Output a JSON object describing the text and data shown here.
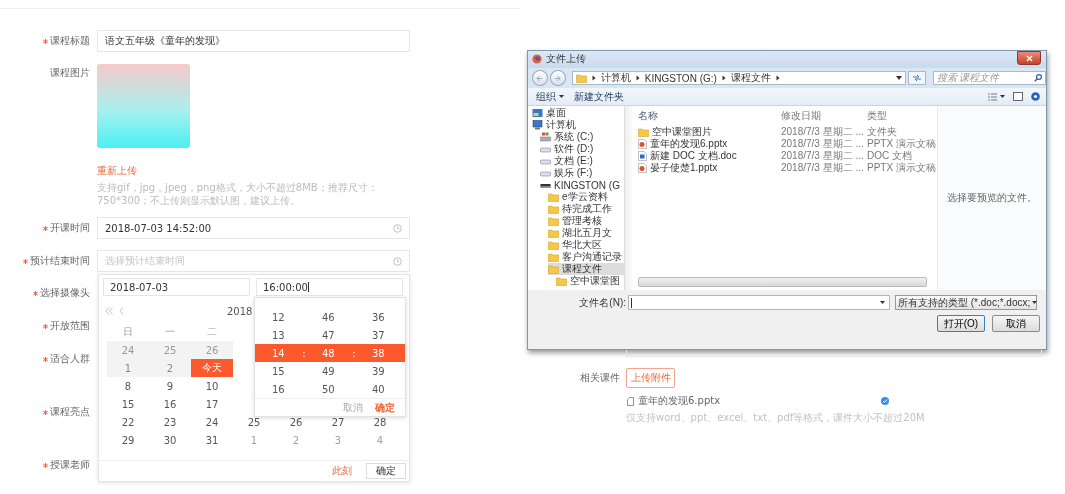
{
  "course_form": {
    "fields": [
      {
        "kind": "text",
        "label": "课程标题",
        "required": true,
        "value": "语文五年级《童年的发现》"
      },
      {
        "kind": "image",
        "label": "课程图片",
        "required": false,
        "link": "重新上传",
        "hint": "支持gif，jpg，jpeg，png格式，大小不超过8MB；推荐尺寸：750*300；不上传则显示默认图，建议上传。"
      },
      {
        "kind": "time",
        "label": "开课时间",
        "required": true,
        "value": "2018-07-03 14:52:00"
      },
      {
        "kind": "time",
        "label": "预计结束时间",
        "required": true,
        "placeholder": "选择预计结束时间"
      },
      {
        "kind": "select",
        "label": "选择摄像头",
        "required": true
      },
      {
        "kind": "select",
        "label": "开放范围",
        "required": true
      },
      {
        "kind": "textarea",
        "label": "适合人群",
        "required": true
      },
      {
        "kind": "textarea",
        "label": "课程亮点",
        "required": true
      },
      {
        "kind": "select",
        "label": "授课老师",
        "required": true
      }
    ]
  },
  "date_picker": {
    "date_value": "2018-07-03",
    "time_value": "16:00:00",
    "year": "2018",
    "weekdays": [
      "日",
      "一",
      "二"
    ],
    "weeks": [
      [
        {
          "text": "24",
          "other_month": true,
          "disabled": true,
          "selected": false
        },
        {
          "text": "25",
          "other_month": true,
          "disabled": true,
          "selected": false
        },
        {
          "text": "26",
          "other_month": true,
          "disabled": true,
          "selected": false
        }
      ],
      [
        {
          "text": "1",
          "other_month": false,
          "disabled": true,
          "selected": false
        },
        {
          "text": "2",
          "other_month": false,
          "disabled": true,
          "selected": false
        },
        {
          "text": "今天",
          "other_month": false,
          "disabled": false,
          "selected": true
        }
      ],
      [
        {
          "text": "8",
          "other_month": false,
          "disabled": false,
          "selected": false
        },
        {
          "text": "9",
          "other_month": false,
          "disabled": false,
          "selected": false
        },
        {
          "text": "10",
          "other_month": false,
          "disabled": false,
          "selected": false
        }
      ],
      [
        {
          "text": "15",
          "other_month": false,
          "disabled": false,
          "selected": false
        },
        {
          "text": "16",
          "other_month": false,
          "disabled": false,
          "selected": false
        },
        {
          "text": "17",
          "other_month": false,
          "disabled": false,
          "selected": false
        }
      ],
      [
        {
          "text": "22",
          "other_month": false,
          "disabled": false,
          "selected": false
        },
        {
          "text": "23",
          "other_month": false,
          "disabled": false,
          "selected": false
        },
        {
          "text": "24",
          "other_month": false,
          "disabled": false,
          "selected": false
        },
        {
          "text": "25",
          "other_month": false,
          "disabled": false,
          "selected": false
        },
        {
          "text": "26",
          "other_month": false,
          "disabled": false,
          "selected": false
        },
        {
          "text": "27",
          "other_month": false,
          "disabled": false,
          "selected": false
        },
        {
          "text": "28",
          "other_month": false,
          "disabled": false,
          "selected": false
        }
      ],
      [
        {
          "text": "29",
          "other_month": false,
          "disabled": false,
          "selected": false
        },
        {
          "text": "30",
          "other_month": false,
          "disabled": false,
          "selected": false
        },
        {
          "text": "31",
          "other_month": false,
          "disabled": false,
          "selected": false
        },
        {
          "text": "1",
          "other_month": true,
          "disabled": false,
          "selected": false
        },
        {
          "text": "2",
          "other_month": true,
          "disabled": false,
          "selected": false
        },
        {
          "text": "3",
          "other_month": true,
          "disabled": false,
          "selected": false
        },
        {
          "text": "4",
          "other_month": true,
          "disabled": false,
          "selected": false
        }
      ]
    ],
    "now_link": "此刻",
    "confirm": "确定",
    "time_panel": {
      "separator": ":",
      "rows": [
        {
          "hour": "12",
          "minute": "46",
          "second": "36",
          "selected": false
        },
        {
          "hour": "13",
          "minute": "47",
          "second": "37",
          "selected": false
        },
        {
          "hour": "14",
          "minute": "48",
          "second": "38",
          "selected": true
        },
        {
          "hour": "15",
          "minute": "49",
          "second": "39",
          "selected": false
        },
        {
          "hour": "16",
          "minute": "50",
          "second": "40",
          "selected": false
        }
      ],
      "cancel": "取消",
      "confirm": "确定"
    }
  },
  "file_dialog": {
    "title": "文件上传",
    "path": [
      "计算机",
      "KINGSTON (G:)",
      "课程文件"
    ],
    "search_placeholder": "搜索 课程文件",
    "toolbar": [
      {
        "label": "组织",
        "dropdown": true
      },
      {
        "label": "新建文件夹",
        "dropdown": false
      }
    ],
    "nav_tree": [
      {
        "label": "桌面",
        "kind": "desktop",
        "selected": false
      },
      {
        "label": "计算机",
        "kind": "computer",
        "selected": false,
        "children": [
          {
            "label": "系统 (C:)",
            "kind": "system-drive",
            "selected": false
          },
          {
            "label": "软件 (D:)",
            "kind": "drive",
            "selected": false
          },
          {
            "label": "文档 (E:)",
            "kind": "drive",
            "selected": false
          },
          {
            "label": "娱乐 (F:)",
            "kind": "drive",
            "selected": false
          },
          {
            "label": "KINGSTON (G",
            "kind": "usb",
            "selected": false,
            "children": [
              {
                "label": "e学云资料",
                "kind": "folder",
                "selected": false
              },
              {
                "label": "待完成工作",
                "kind": "folder",
                "selected": false
              },
              {
                "label": "管理考核",
                "kind": "folder",
                "selected": false
              },
              {
                "label": "湖北五月文",
                "kind": "folder",
                "selected": false
              },
              {
                "label": "华北大区",
                "kind": "folder",
                "selected": false
              },
              {
                "label": "客户沟通记录",
                "kind": "folder",
                "selected": false
              },
              {
                "label": "课程文件",
                "kind": "folder",
                "selected": true,
                "children": [
                  {
                    "label": "空中课堂图",
                    "kind": "folder",
                    "selected": false
                  }
                ]
              }
            ]
          }
        ]
      }
    ],
    "columns": [
      "名称",
      "修改日期",
      "类型"
    ],
    "files": [
      {
        "name": "空中课堂图片",
        "date": "2018/7/3 星期二 ...",
        "type": "文件夹",
        "kind": "folder"
      },
      {
        "name": "童年的发现6.pptx",
        "date": "2018/7/3 星期二 ...",
        "type": "PPTX 演示文稿",
        "kind": "pptx"
      },
      {
        "name": "新建 DOC 文档.doc",
        "date": "2018/7/3 星期二 ...",
        "type": "DOC 文档",
        "kind": "doc"
      },
      {
        "name": "晏子使楚1.pptx",
        "date": "2018/7/3 星期二 ...",
        "type": "PPTX 演示文稿",
        "kind": "pptx"
      }
    ],
    "preview_text": "选择要预览的文件。",
    "file_name_label": "文件名(N):",
    "file_type": "所有支持的类型 (*.doc;*.docx;",
    "buttons": [
      "打开(O)",
      "取消"
    ]
  },
  "attachments": {
    "label": "相关课件",
    "upload_button": "上传附件",
    "files": [
      {
        "name": "童年的发现6.pptx",
        "uploaded": true
      }
    ],
    "hint": "仅支持word、ppt、excel、txt、pdf等格式，课件大小不超过20M"
  }
}
